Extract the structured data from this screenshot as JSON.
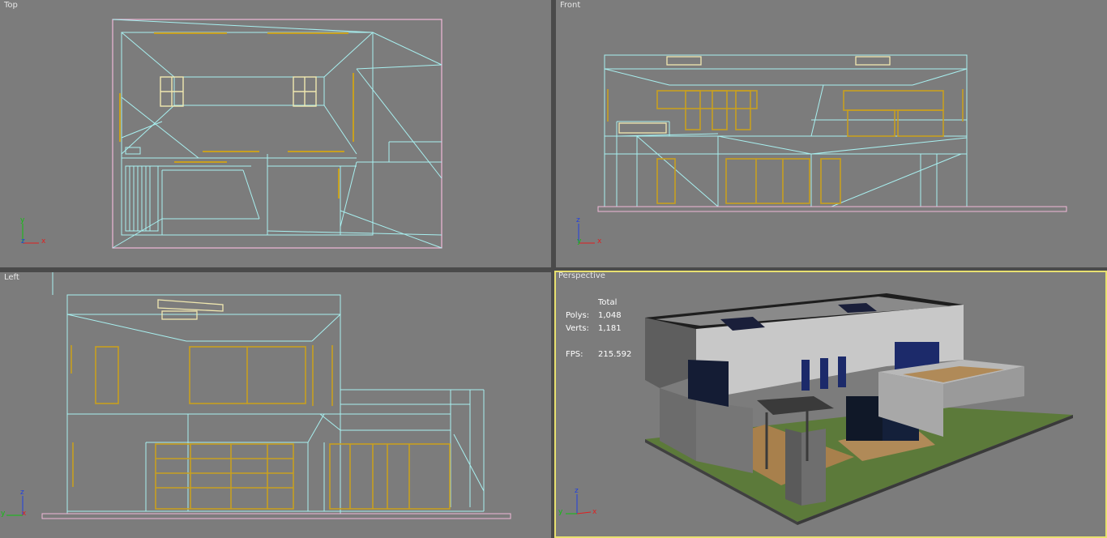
{
  "viewports": {
    "top": {
      "label": "Top"
    },
    "front": {
      "label": "Front"
    },
    "left": {
      "label": "Left"
    },
    "perspective": {
      "label": "Perspective"
    }
  },
  "stats": {
    "header": "Total",
    "polys_label": "Polys:",
    "polys_value": "1,048",
    "verts_label": "Verts:",
    "verts_value": "1,181",
    "fps_label": "FPS:",
    "fps_value": "215.592"
  },
  "axes": {
    "x": "x",
    "y": "y",
    "z": "z"
  },
  "colors": {
    "viewport_bg": "#7c7c7c",
    "wire_cyan": "#a8f0f0",
    "wire_pink": "#f0b8d8",
    "wire_yellow": "#f0e8b0",
    "window_gold": "#c8a020",
    "active_border": "#e8e070"
  }
}
